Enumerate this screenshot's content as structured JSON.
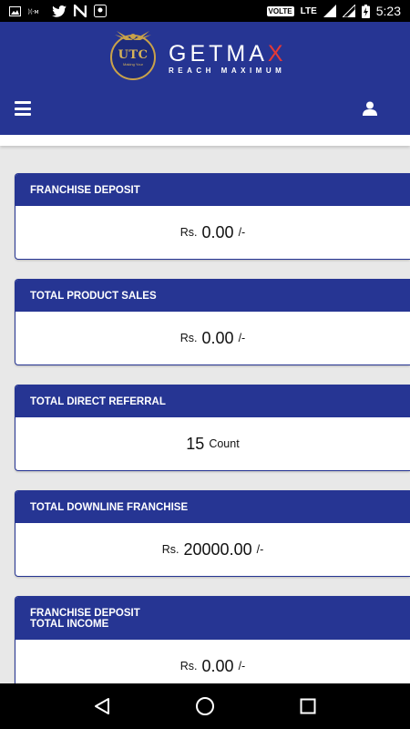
{
  "status_bar": {
    "network_label": "VOLTE",
    "lte_label": "LTE",
    "time": "5:23"
  },
  "header": {
    "logo_text": "UTC",
    "logo_subtext": "Making Your",
    "brand_name": "GETMA",
    "brand_name_accent": "X",
    "tagline": "REACH MAXIMUM"
  },
  "cards": [
    {
      "title": "FRANCHISE DEPOSIT",
      "prefix": "Rs.",
      "value": "0.00",
      "suffix": "/-"
    },
    {
      "title": "TOTAL PRODUCT SALES",
      "prefix": "Rs.",
      "value": "0.00",
      "suffix": "/-"
    },
    {
      "title": "TOTAL DIRECT REFERRAL",
      "prefix": "",
      "value": "15",
      "suffix": "Count"
    },
    {
      "title": "TOTAL DOWNLINE FRANCHISE",
      "prefix": "Rs.",
      "value": "20000.00",
      "suffix": "/-"
    },
    {
      "title_line1": "FRANCHISE DEPOSIT",
      "title_line2": "TOTAL INCOME",
      "prefix": "Rs.",
      "value": "0.00",
      "suffix": "/-"
    }
  ],
  "colors": {
    "primary": "#263593",
    "accent_red": "#e53935",
    "logo_gold": "#c9a24a"
  }
}
